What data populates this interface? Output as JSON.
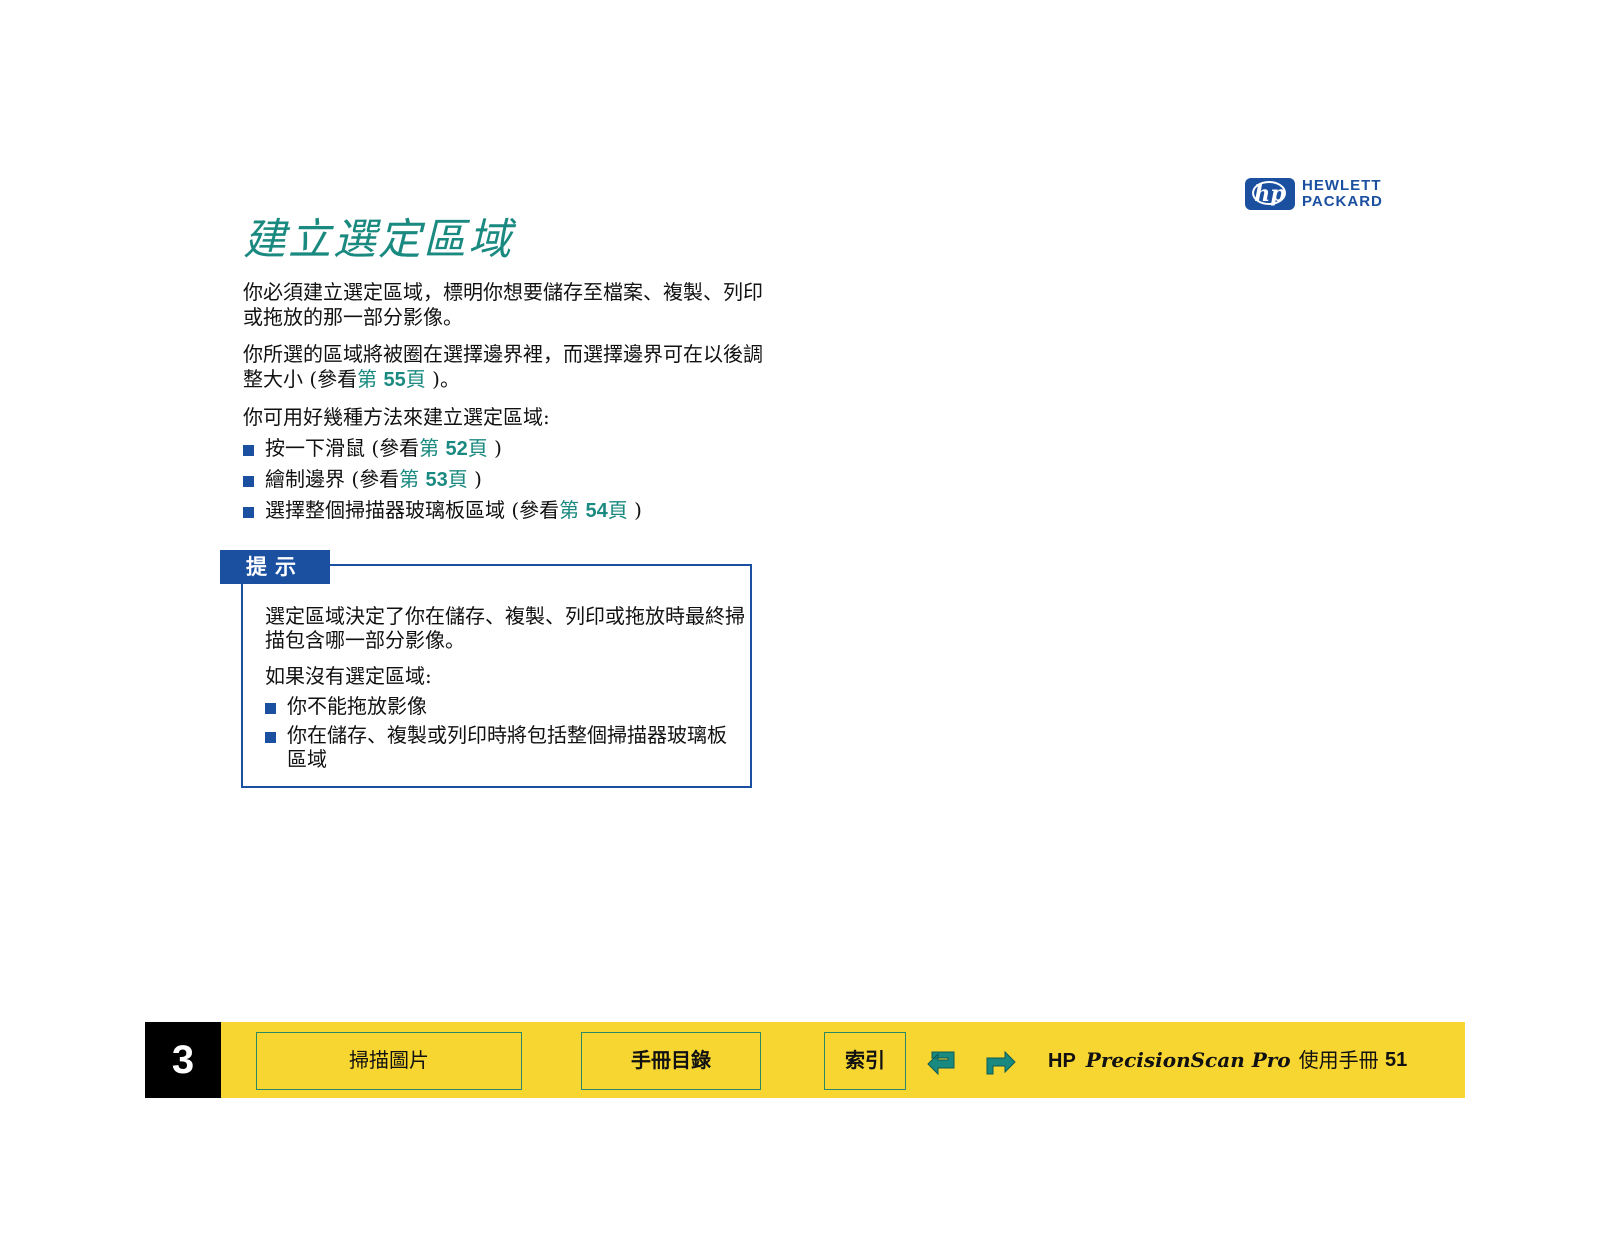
{
  "logo": {
    "mark": "hp",
    "line1": "HEWLETT",
    "line2": "PACKARD"
  },
  "title": "建立選定區域",
  "intro": "你必須建立選定區域，標明你想要儲存至檔案、複製、列印或拖放的那一部分影像。",
  "para2": {
    "text": "你所選的區域將被圈在選擇邊界裡，而選擇邊界可在以後調整大小 (參看",
    "ref_prefix": "第",
    "ref_num": "55",
    "ref_suffix": "頁",
    "tail": " )。"
  },
  "methods_intro": "你可用好幾種方法來建立選定區域:",
  "methods": [
    {
      "text": "按一下滑鼠 (參看",
      "ref_prefix": "第",
      "ref_num": "52",
      "ref_suffix": "頁",
      "tail": " )"
    },
    {
      "text": "繪制邊界 (參看",
      "ref_prefix": "第",
      "ref_num": "53",
      "ref_suffix": "頁",
      "tail": " )"
    },
    {
      "text": "選擇整個掃描器玻璃板區域 (參看",
      "ref_prefix": "第",
      "ref_num": "54",
      "ref_suffix": "頁",
      "tail": " )"
    }
  ],
  "tip": {
    "label": "提示",
    "para1": "選定區域決定了你在儲存、複製、列印或拖放時最終掃描包含哪一部分影像。",
    "para2": "如果沒有選定區域:",
    "items": [
      "你不能拖放影像",
      "你在儲存、複製或列印時將包括整個掃描器玻璃板區域"
    ]
  },
  "footer": {
    "chapter": "3",
    "nav": [
      "掃描圖片",
      "手冊目錄",
      "索引"
    ],
    "hp": "HP",
    "product": "PrecisionScan Pro",
    "manual": "使用手冊",
    "page": "51"
  },
  "colors": {
    "accent": "#1a8a80",
    "blue": "#1b4fa0",
    "footer": "#f7d631"
  }
}
